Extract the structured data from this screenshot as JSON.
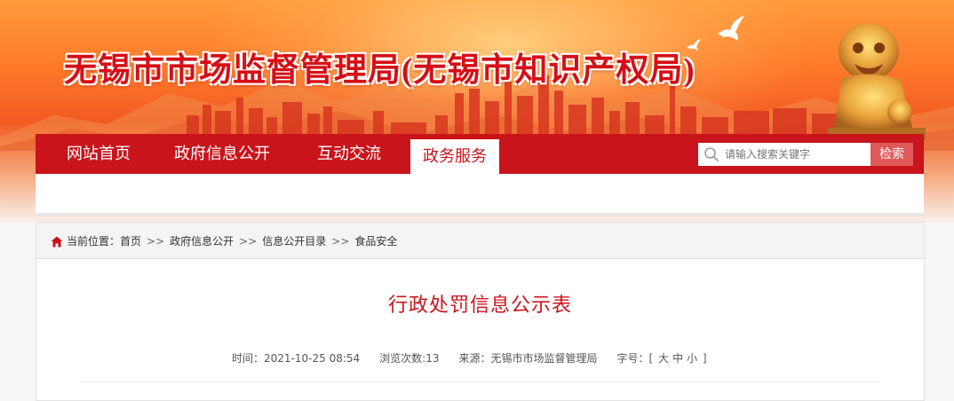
{
  "header": {
    "site_title": "无锡市市场监督管理局(无锡市知识产权局)"
  },
  "nav": {
    "items": [
      {
        "label": "网站首页",
        "active": false
      },
      {
        "label": "政府信息公开",
        "active": false
      },
      {
        "label": "互动交流",
        "active": false
      },
      {
        "label": "政务服务",
        "active": true
      }
    ],
    "search": {
      "placeholder": "请输入搜索关键字",
      "button_label": "检索"
    }
  },
  "breadcrumb": {
    "prefix": "当前位置：",
    "items": [
      "首页",
      "政府信息公开",
      "信息公开目录",
      "食品安全"
    ],
    "separator": ">>"
  },
  "article": {
    "title": "行政处罚信息公示表",
    "meta": {
      "time_label": "时间：",
      "time_value": "2021-10-25 08:54",
      "views_label": "浏览次数:",
      "views_value": "13",
      "source_label": "来源：",
      "source_value": "无锡市市场监督管理局",
      "font_label": "字号：",
      "font_open": "[",
      "font_sizes": [
        "大",
        "中",
        "小"
      ],
      "font_close": "]"
    }
  },
  "colors": {
    "brand_red": "#c9141c",
    "banner_orange": "#ff7a2a",
    "search_button": "#e05a5a"
  }
}
